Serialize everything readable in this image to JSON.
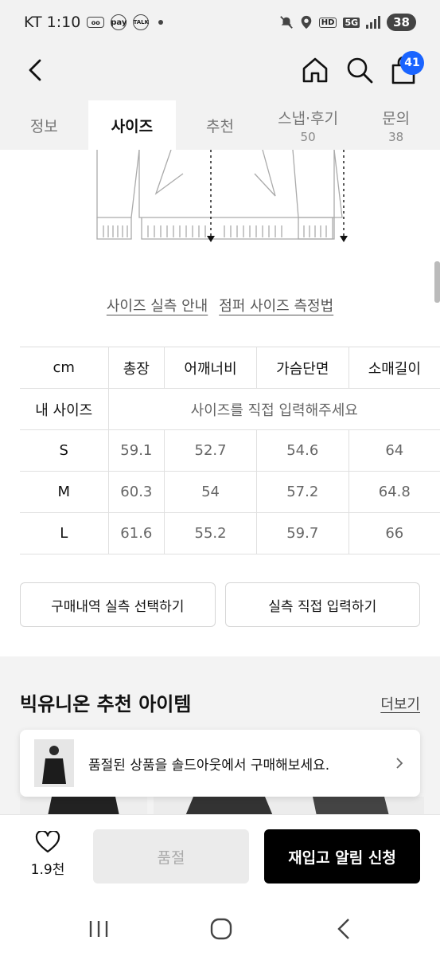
{
  "status_bar": {
    "carrier_time": "KT 1:10",
    "mini_icons": [
      "voicemail-icon",
      "pay",
      "TALK"
    ],
    "network": "5G",
    "battery": "38"
  },
  "header": {
    "cart_count": "41"
  },
  "tabs": [
    {
      "label": "정보",
      "count": ""
    },
    {
      "label": "사이즈",
      "count": ""
    },
    {
      "label": "추천",
      "count": ""
    },
    {
      "label": "스냅·후기",
      "count": "50"
    },
    {
      "label": "문의",
      "count": "38"
    }
  ],
  "links": {
    "size_guide": "사이즈 실측 안내",
    "measure_method": "점퍼 사이즈 측정법"
  },
  "size_table": {
    "headers": [
      "cm",
      "총장",
      "어깨너비",
      "가슴단면",
      "소매길이"
    ],
    "my_size_label": "내 사이즈",
    "my_size_prompt": "사이즈를 직접 입력해주세요",
    "rows": [
      [
        "S",
        "59.1",
        "52.7",
        "54.6",
        "64"
      ],
      [
        "M",
        "60.3",
        "54",
        "57.2",
        "64.8"
      ],
      [
        "L",
        "61.6",
        "55.2",
        "59.7",
        "66"
      ]
    ]
  },
  "buttons": {
    "history_select": "구매내역 실측 선택하기",
    "direct_input": "실측 직접 입력하기"
  },
  "recommend": {
    "title": "빅유니온 추천 아이템",
    "more": "더보기",
    "soldout_banner": "품절된 상품을 솔드아웃에서 구매해보세요."
  },
  "bottom": {
    "like_count": "1.9천",
    "soldout": "품절",
    "restock": "재입고 알림 신청"
  },
  "colors": {
    "accent_blue": "#1a64ff",
    "primary_black": "#000000"
  }
}
